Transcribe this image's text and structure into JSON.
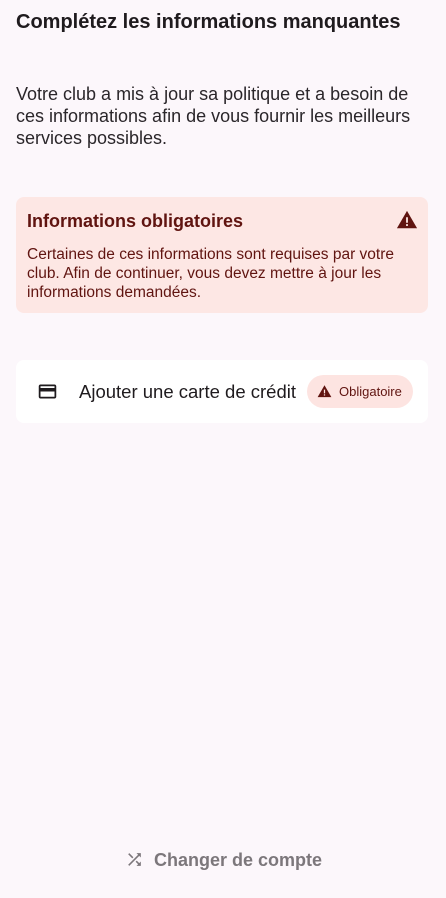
{
  "header": {
    "title": "Complétez les informations manquantes",
    "subtitle": "Votre club a mis à jour sa politique et a besoin de ces informations afin de vous fournir les meilleurs services possibles."
  },
  "alert": {
    "title": "Informations obligatoires",
    "message": "Certaines de ces informations sont requises par votre club. Afin de continuer, vous devez mettre à jour les informations demandées.",
    "icon": "warning-icon",
    "color": "#601410",
    "background": "#fde7e4"
  },
  "requirements": [
    {
      "label": "Ajouter une carte de crédit",
      "icon": "credit-card-icon",
      "badge": "Obligatoire",
      "badge_icon": "warning-icon"
    }
  ],
  "footer": {
    "switch_account_label": "Changer de compte",
    "icon": "shuffle-icon"
  },
  "colors": {
    "background": "#fcf7fb",
    "text": "#1f1b1e",
    "muted": "#7c777b",
    "error": "#601410"
  }
}
